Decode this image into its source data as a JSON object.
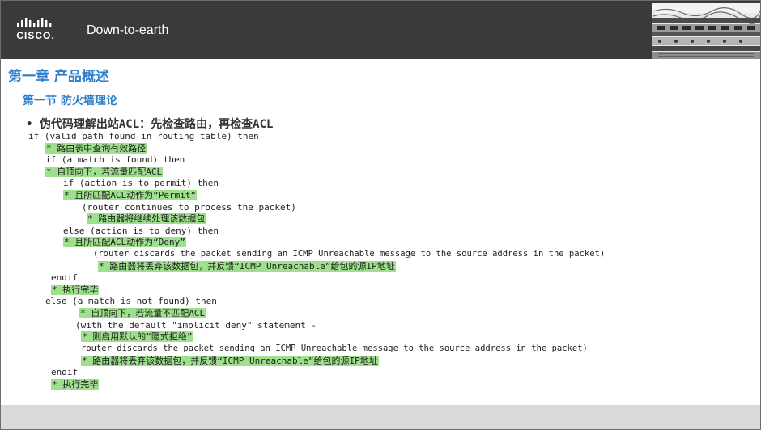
{
  "header": {
    "logo_text": "CISCO.",
    "title": "Down-to-earth"
  },
  "content": {
    "chapter_title": "第一章 产品概述",
    "section_title": "第一节 防火墙理论",
    "bullet": "• 伪代码理解出站ACL：先检查路由，再检查ACL"
  },
  "code_lines": [
    {
      "text": "if (valid path found in routing table) then",
      "comment": false
    },
    {
      "text": "* 路由表中查询有效路径",
      "comment": true
    },
    {
      "text": "if (a match is found) then",
      "comment": false
    },
    {
      "text": "* 自顶向下，若流量匹配ACL",
      "comment": true
    },
    {
      "text": "if (action is to permit) then",
      "comment": false
    },
    {
      "text": "* 且所匹配ACL动作为“Permit”",
      "comment": true
    },
    {
      "text": "(router continues to process the packet)",
      "comment": false
    },
    {
      "text": "* 路由器将继续处理该数据包",
      "comment": true
    },
    {
      "text": "else (action is to deny) then",
      "comment": false
    },
    {
      "text": "* 且所匹配ACL动作为“Deny”",
      "comment": true
    },
    {
      "text": "(router discards the packet sending an ICMP Unreachable message to the source address in the packet)",
      "comment": false
    },
    {
      "text": "* 路由器将丢弃该数据包，并反馈“ICMP Unreachable”给包的源IP地址",
      "comment": true
    },
    {
      "text": "endif",
      "comment": false
    },
    {
      "text": "* 执行完毕",
      "comment": true
    },
    {
      "text": "else (a match is not found) then",
      "comment": false
    },
    {
      "text": "* 自顶向下，若流量不匹配ACL",
      "comment": true
    },
    {
      "text": "(with the default \"implicit deny\" statement -",
      "comment": false
    },
    {
      "text": "* 则启用默认的“隐式拒绝”",
      "comment": true
    },
    {
      "text": "router discards the packet sending an ICMP Unreachable message to the source address in the packet)",
      "comment": false
    },
    {
      "text": "* 路由器将丢弃该数据包，并反馈“ICMP Unreachable”给包的源IP地址",
      "comment": true
    },
    {
      "text": "endif",
      "comment": false
    },
    {
      "text": "* 执行完毕",
      "comment": true
    }
  ]
}
